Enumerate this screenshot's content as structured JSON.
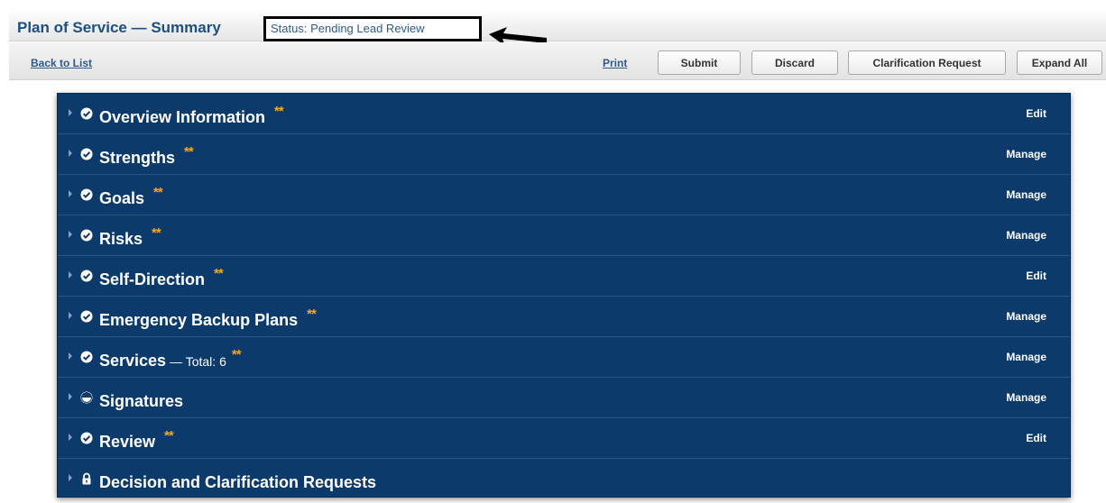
{
  "header": {
    "title": "Plan of Service — Summary",
    "status": "Status: Pending Lead Review"
  },
  "toolbar": {
    "back_label": "Back to List",
    "print_label": "Print",
    "submit_label": "Submit",
    "discard_label": "Discard",
    "clarification_label": "Clarification Request",
    "expand_label": "Expand All"
  },
  "sections": [
    {
      "title": "Overview Information",
      "extra": "",
      "stars": "**",
      "action": "Edit",
      "icon": "check-circle-icon"
    },
    {
      "title": "Strengths",
      "extra": "",
      "stars": "**",
      "action": "Manage",
      "icon": "check-circle-icon"
    },
    {
      "title": "Goals",
      "extra": "",
      "stars": "**",
      "action": "Manage",
      "icon": "check-circle-icon"
    },
    {
      "title": "Risks",
      "extra": "",
      "stars": "**",
      "action": "Manage",
      "icon": "check-circle-icon"
    },
    {
      "title": "Self-Direction",
      "extra": "",
      "stars": "**",
      "action": "Edit",
      "icon": "check-circle-icon"
    },
    {
      "title": "Emergency Backup Plans",
      "extra": "",
      "stars": "**",
      "action": "Manage",
      "icon": "check-circle-icon"
    },
    {
      "title": "Services",
      "extra": "— Total: 6",
      "stars": "**",
      "action": "Manage",
      "icon": "check-circle-icon"
    },
    {
      "title": "Signatures",
      "extra": "",
      "stars": "",
      "action": "Manage",
      "icon": "half-circle-icon"
    },
    {
      "title": "Review",
      "extra": "",
      "stars": "**",
      "action": "Edit",
      "icon": "check-circle-icon"
    },
    {
      "title": "Decision and Clarification Requests",
      "extra": "",
      "stars": "",
      "action": "",
      "icon": "lock-icon"
    }
  ],
  "colors": {
    "panel": "#0b3a6b",
    "stars": "#f5a81e",
    "title": "#1f4f7f",
    "link": "#2d5b8c"
  }
}
